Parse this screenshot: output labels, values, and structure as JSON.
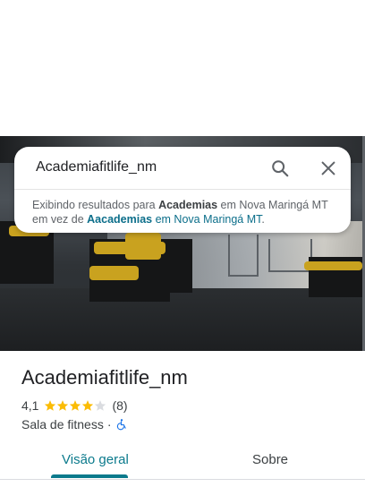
{
  "search": {
    "query": "Academiafitlife_nm",
    "notice": {
      "prefix": "Exibindo resultados para ",
      "term": "Academias",
      "middle": " em Nova Maringá MT",
      "line2_prefix": "em vez de ",
      "alt_term": "Aacademias",
      "alt_suffix": " em Nova Maringá MT",
      "end": "."
    }
  },
  "place": {
    "name": "Academiafitlife_nm",
    "rating": "4,1",
    "rating_value": 4.1,
    "review_count": "(8)",
    "category": "Sala de fitness",
    "separator": "·"
  },
  "tabs": [
    {
      "label": "Visão geral",
      "active": true
    },
    {
      "label": "Sobre",
      "active": false
    }
  ],
  "colors": {
    "accent": "#0b7a8c",
    "star": "#fbbc04",
    "star_empty": "#dadce0"
  },
  "icons": [
    "search-icon",
    "close-icon",
    "star-icon",
    "wheelchair-icon"
  ]
}
